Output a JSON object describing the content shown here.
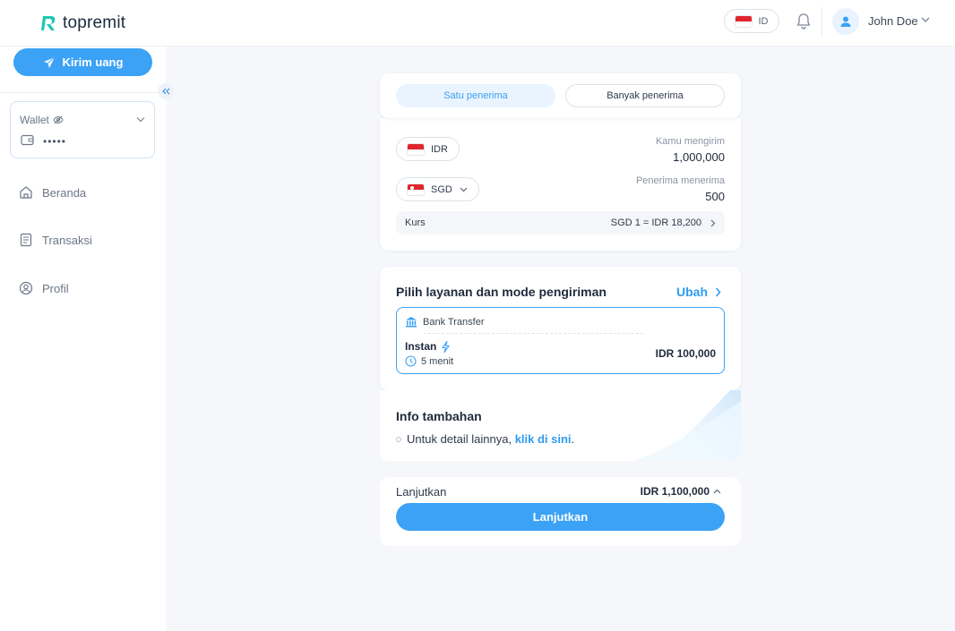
{
  "app": {
    "logo_text": "topremit"
  },
  "header": {
    "language": "ID",
    "user_name": "John Doe"
  },
  "sidebar": {
    "send_label": "Kirim uang",
    "wallet": {
      "label": "Wallet",
      "masked_balance": "•••••"
    },
    "items": [
      {
        "label": "Beranda",
        "icon": "home-icon"
      },
      {
        "label": "Transaksi",
        "icon": "document-icon"
      },
      {
        "label": "Profil",
        "icon": "user-circle-icon"
      }
    ]
  },
  "tabs": [
    {
      "label": "Satu penerima",
      "active": true
    },
    {
      "label": "Banyak penerima",
      "active": false
    }
  ],
  "amount": {
    "send_currency": "IDR",
    "send_label": "Kamu mengirim",
    "send_value": "1,000,000",
    "receive_currency": "SGD",
    "receive_label": "Penerima menerima",
    "receive_value": "500",
    "rate_label": "Kurs",
    "rate_value": "SGD 1 = IDR 18,200"
  },
  "service": {
    "title": "Pilih layanan dan mode pengiriman",
    "change_label": "Ubah",
    "method": "Bank Transfer",
    "mode": "Instan",
    "duration": "5 menit",
    "fee": "IDR 100,000"
  },
  "info": {
    "title": "Info tambahan",
    "text": "Untuk detail lainnya, ",
    "link": "klik di sini",
    "suffix": "."
  },
  "continue": {
    "label": "Lanjutkan",
    "total": "IDR 1,100,000",
    "button": "Lanjutkan"
  },
  "colors": {
    "accent": "#3ba2f5",
    "brand_logo": "#1ec8b0",
    "background": "#f5f7fb"
  }
}
